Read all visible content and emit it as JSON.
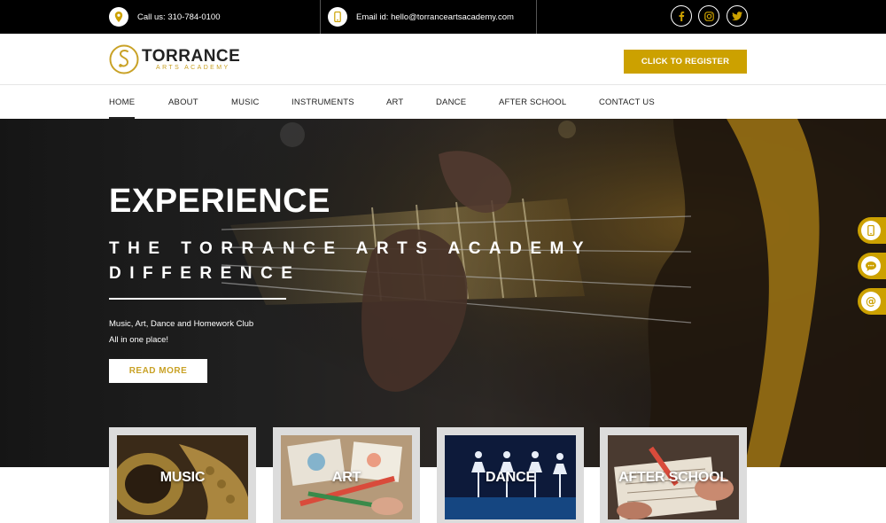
{
  "topbar": {
    "phone_text": "Call us: 310-784-0100",
    "email_text": "Email id: hello@torranceartsacademy.com",
    "social": [
      "facebook-icon",
      "instagram-icon",
      "twitter-icon"
    ]
  },
  "header": {
    "logo_name": "TORRANCE",
    "logo_sub": "ARTS ACADEMY",
    "register_label": "CLICK TO REGISTER"
  },
  "nav": {
    "items": [
      "HOME",
      "ABOUT",
      "MUSIC",
      "INSTRUMENTS",
      "ART",
      "DANCE",
      "AFTER SCHOOL",
      "CONTACT US"
    ],
    "active": "HOME"
  },
  "hero": {
    "title": "EXPERIENCE",
    "subtitle": "THE TORRANCE ARTS ACADEMY DIFFERENCE",
    "desc_line1": "Music, Art, Dance and Homework Club",
    "desc_line2": "All in one place!",
    "cta_label": "READ MORE"
  },
  "side_buttons": [
    "phone-icon",
    "chat-icon",
    "email-icon"
  ],
  "cards": [
    {
      "label": "MUSIC"
    },
    {
      "label": "ART"
    },
    {
      "label": "DANCE"
    },
    {
      "label": "AFTER SCHOOL"
    }
  ],
  "colors": {
    "accent": "#cca100",
    "topbar": "#000000",
    "text": "#222222"
  }
}
